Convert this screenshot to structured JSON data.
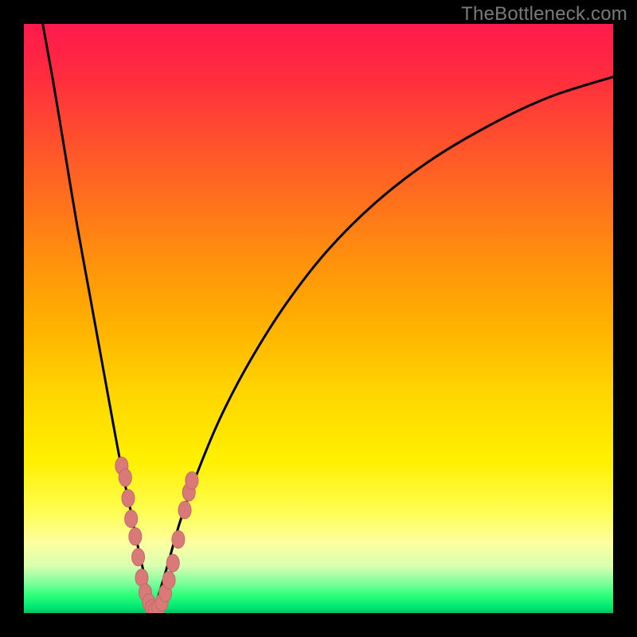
{
  "watermark": {
    "text": "TheBottleneck.com"
  },
  "colors": {
    "background_frame": "#000000",
    "curve_stroke": "#000000",
    "marker_fill": "#d97a78",
    "marker_stroke": "#c06a68",
    "gradient_top": "#ff1a4d",
    "gradient_mid": "#ffd400",
    "gradient_bottom": "#00c060"
  },
  "chart_data": {
    "type": "line",
    "title": "",
    "xlabel": "",
    "ylabel": "",
    "x_range": [
      0,
      100
    ],
    "y_range": [
      0,
      100
    ],
    "note": "Two V-shaped bottleneck curves meeting near x≈22 at y≈0; values are estimated from pixel positions (no axis labels present). Color gradient encodes y from red (high) through orange/yellow to green (low).",
    "series": [
      {
        "name": "left-arm",
        "x": [
          3.2,
          5.0,
          7.0,
          9.0,
          11.0,
          13.0,
          15.0,
          16.5,
          18.0,
          19.2,
          20.2,
          21.0,
          21.6,
          22.0
        ],
        "y": [
          100.0,
          90.0,
          78.0,
          66.0,
          55.0,
          44.0,
          33.0,
          25.0,
          18.0,
          12.0,
          7.5,
          3.8,
          1.4,
          0.0
        ]
      },
      {
        "name": "right-arm",
        "x": [
          22.0,
          23.0,
          24.5,
          26.5,
          29.5,
          33.5,
          38.5,
          44.5,
          51.5,
          59.5,
          68.5,
          78.5,
          89.0,
          100.0
        ],
        "y": [
          0.0,
          3.5,
          8.5,
          15.5,
          24.0,
          33.5,
          43.0,
          52.5,
          61.5,
          69.5,
          76.5,
          82.5,
          87.5,
          91.0
        ]
      }
    ],
    "markers": {
      "name": "data-points",
      "points": [
        {
          "x": 16.6,
          "y": 25.0
        },
        {
          "x": 17.2,
          "y": 23.0
        },
        {
          "x": 17.7,
          "y": 19.5
        },
        {
          "x": 18.2,
          "y": 16.0
        },
        {
          "x": 18.9,
          "y": 13.0
        },
        {
          "x": 19.4,
          "y": 9.5
        },
        {
          "x": 20.0,
          "y": 6.0
        },
        {
          "x": 20.6,
          "y": 3.5
        },
        {
          "x": 21.2,
          "y": 1.8
        },
        {
          "x": 21.7,
          "y": 0.8
        },
        {
          "x": 22.2,
          "y": 0.4
        },
        {
          "x": 22.8,
          "y": 0.8
        },
        {
          "x": 23.4,
          "y": 1.8
        },
        {
          "x": 24.0,
          "y": 3.4
        },
        {
          "x": 24.6,
          "y": 5.6
        },
        {
          "x": 25.3,
          "y": 8.5
        },
        {
          "x": 26.2,
          "y": 12.5
        },
        {
          "x": 27.3,
          "y": 17.5
        },
        {
          "x": 28.0,
          "y": 20.5
        },
        {
          "x": 28.5,
          "y": 22.5
        }
      ]
    }
  }
}
